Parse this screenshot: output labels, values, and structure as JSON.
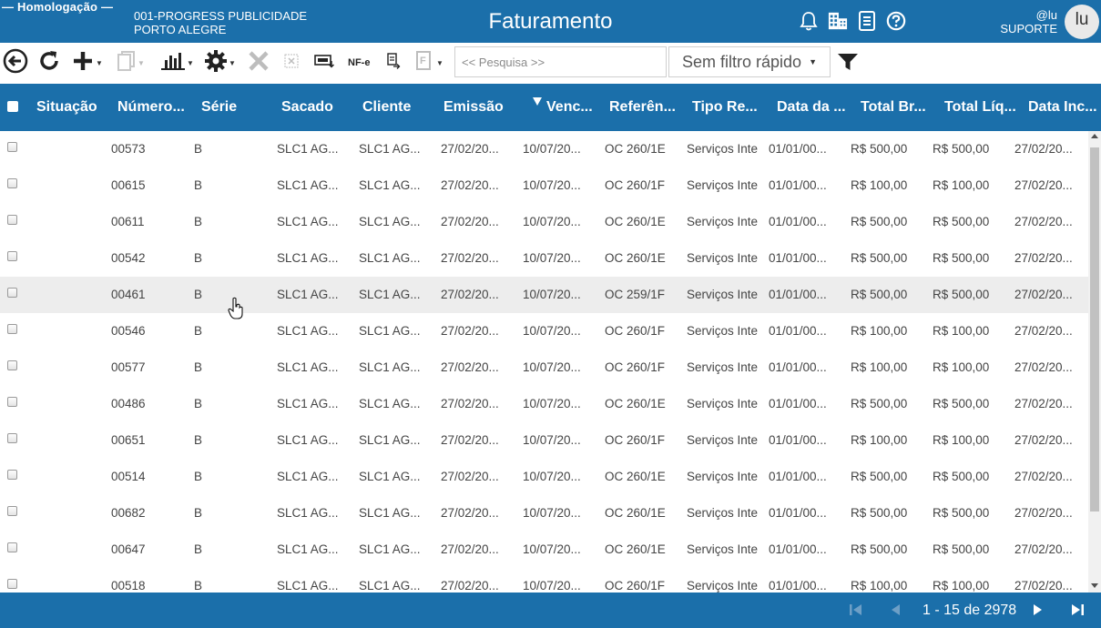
{
  "header": {
    "environment": "— Homologação —",
    "company_line1": "001-PROGRESS PUBLICIDADE",
    "company_line2": "PORTO ALEGRE",
    "title": "Faturamento",
    "user_handle": "@lu",
    "user_role": "SUPORTE",
    "avatar_initials": "lu",
    "icons": [
      "bell-icon",
      "building-icon",
      "document-icon",
      "help-icon"
    ]
  },
  "toolbar": {
    "nfe_label": "NF-e",
    "search_placeholder": "<< Pesquisa >>",
    "quick_filter_value": "Sem filtro rápido",
    "icons": [
      "back-icon",
      "refresh-icon",
      "add-icon",
      "copy-icon",
      "chart-icon",
      "settings-icon",
      "delete-icon",
      "cancel-icon",
      "invoice-icon",
      "nfe-icon",
      "print-icon",
      "report-icon",
      "filter-icon"
    ]
  },
  "grid": {
    "columns": [
      "Situação",
      "Número...",
      "Série",
      "Sacado",
      "Cliente",
      "Emissão",
      "Venc...",
      "Referên...",
      "Tipo Re...",
      "Data da ...",
      "Total Br...",
      "Total Líq...",
      "Data Inc..."
    ],
    "sorted_column": "Venc...",
    "rows": [
      {
        "numero": "00573",
        "serie": "B",
        "sacado": "SLC1 AG...",
        "cliente": "SLC1 AG...",
        "emissao": "27/02/20...",
        "venc": "10/07/20...",
        "referencia": "OC 260/1E",
        "tipo": "Serviços Inte",
        "data": "01/01/00...",
        "total_bruto": "R$ 500,00",
        "total_liquido": "R$ 500,00",
        "data_inc": "27/02/20..."
      },
      {
        "numero": "00615",
        "serie": "B",
        "sacado": "SLC1 AG...",
        "cliente": "SLC1 AG...",
        "emissao": "27/02/20...",
        "venc": "10/07/20...",
        "referencia": "OC 260/1F",
        "tipo": "Serviços Inte",
        "data": "01/01/00...",
        "total_bruto": "R$ 100,00",
        "total_liquido": "R$ 100,00",
        "data_inc": "27/02/20..."
      },
      {
        "numero": "00611",
        "serie": "B",
        "sacado": "SLC1 AG...",
        "cliente": "SLC1 AG...",
        "emissao": "27/02/20...",
        "venc": "10/07/20...",
        "referencia": "OC 260/1E",
        "tipo": "Serviços Inte",
        "data": "01/01/00...",
        "total_bruto": "R$ 500,00",
        "total_liquido": "R$ 500,00",
        "data_inc": "27/02/20..."
      },
      {
        "numero": "00542",
        "serie": "B",
        "sacado": "SLC1 AG...",
        "cliente": "SLC1 AG...",
        "emissao": "27/02/20...",
        "venc": "10/07/20...",
        "referencia": "OC 260/1E",
        "tipo": "Serviços Inte",
        "data": "01/01/00...",
        "total_bruto": "R$ 500,00",
        "total_liquido": "R$ 500,00",
        "data_inc": "27/02/20..."
      },
      {
        "numero": "00461",
        "serie": "B",
        "sacado": "SLC1 AG...",
        "cliente": "SLC1 AG...",
        "emissao": "27/02/20...",
        "venc": "10/07/20...",
        "referencia": "OC 259/1F",
        "tipo": "Serviços Inte",
        "data": "01/01/00...",
        "total_bruto": "R$ 500,00",
        "total_liquido": "R$ 500,00",
        "data_inc": "27/02/20..."
      },
      {
        "numero": "00546",
        "serie": "B",
        "sacado": "SLC1 AG...",
        "cliente": "SLC1 AG...",
        "emissao": "27/02/20...",
        "venc": "10/07/20...",
        "referencia": "OC 260/1F",
        "tipo": "Serviços Inte",
        "data": "01/01/00...",
        "total_bruto": "R$ 100,00",
        "total_liquido": "R$ 100,00",
        "data_inc": "27/02/20..."
      },
      {
        "numero": "00577",
        "serie": "B",
        "sacado": "SLC1 AG...",
        "cliente": "SLC1 AG...",
        "emissao": "27/02/20...",
        "venc": "10/07/20...",
        "referencia": "OC 260/1F",
        "tipo": "Serviços Inte",
        "data": "01/01/00...",
        "total_bruto": "R$ 100,00",
        "total_liquido": "R$ 100,00",
        "data_inc": "27/02/20..."
      },
      {
        "numero": "00486",
        "serie": "B",
        "sacado": "SLC1 AG...",
        "cliente": "SLC1 AG...",
        "emissao": "27/02/20...",
        "venc": "10/07/20...",
        "referencia": "OC 260/1E",
        "tipo": "Serviços Inte",
        "data": "01/01/00...",
        "total_bruto": "R$ 500,00",
        "total_liquido": "R$ 500,00",
        "data_inc": "27/02/20..."
      },
      {
        "numero": "00651",
        "serie": "B",
        "sacado": "SLC1 AG...",
        "cliente": "SLC1 AG...",
        "emissao": "27/02/20...",
        "venc": "10/07/20...",
        "referencia": "OC 260/1F",
        "tipo": "Serviços Inte",
        "data": "01/01/00...",
        "total_bruto": "R$ 100,00",
        "total_liquido": "R$ 100,00",
        "data_inc": "27/02/20..."
      },
      {
        "numero": "00514",
        "serie": "B",
        "sacado": "SLC1 AG...",
        "cliente": "SLC1 AG...",
        "emissao": "27/02/20...",
        "venc": "10/07/20...",
        "referencia": "OC 260/1E",
        "tipo": "Serviços Inte",
        "data": "01/01/00...",
        "total_bruto": "R$ 500,00",
        "total_liquido": "R$ 500,00",
        "data_inc": "27/02/20..."
      },
      {
        "numero": "00682",
        "serie": "B",
        "sacado": "SLC1 AG...",
        "cliente": "SLC1 AG...",
        "emissao": "27/02/20...",
        "venc": "10/07/20...",
        "referencia": "OC 260/1E",
        "tipo": "Serviços Inte",
        "data": "01/01/00...",
        "total_bruto": "R$ 500,00",
        "total_liquido": "R$ 500,00",
        "data_inc": "27/02/20..."
      },
      {
        "numero": "00647",
        "serie": "B",
        "sacado": "SLC1 AG...",
        "cliente": "SLC1 AG...",
        "emissao": "27/02/20...",
        "venc": "10/07/20...",
        "referencia": "OC 260/1E",
        "tipo": "Serviços Inte",
        "data": "01/01/00...",
        "total_bruto": "R$ 500,00",
        "total_liquido": "R$ 500,00",
        "data_inc": "27/02/20..."
      },
      {
        "numero": "00518",
        "serie": "B",
        "sacado": "SLC1 AG...",
        "cliente": "SLC1 AG...",
        "emissao": "27/02/20...",
        "venc": "10/07/20...",
        "referencia": "OC 260/1F",
        "tipo": "Serviços Inte",
        "data": "01/01/00...",
        "total_bruto": "R$ 100,00",
        "total_liquido": "R$ 100,00",
        "data_inc": "27/02/20..."
      }
    ],
    "hovered_row": 4
  },
  "footer": {
    "page_info": "1 - 15 de 2978",
    "icons": [
      "first-page-icon",
      "prev-page-icon",
      "next-page-icon",
      "last-page-icon"
    ]
  }
}
